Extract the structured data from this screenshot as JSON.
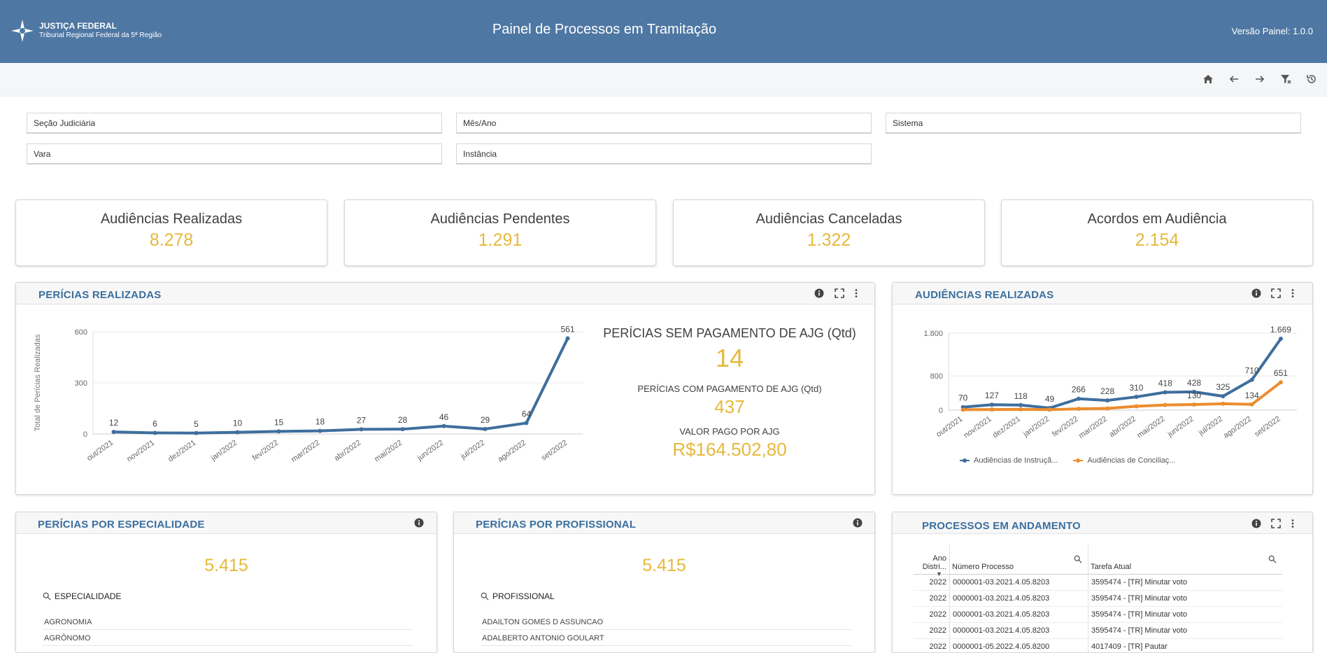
{
  "header": {
    "logo_title": "JUSTIÇA FEDERAL",
    "logo_subtitle": "Tribunal Regional Federal da 5ª Região",
    "title": "Painel de Processos em Tramitação",
    "version": "Versão Painel: 1.0.0"
  },
  "toolbar": {
    "icons": [
      "home-icon",
      "back-icon",
      "forward-icon",
      "clear-filter-icon",
      "history-icon"
    ]
  },
  "filters": {
    "secao": "Seção Judiciária",
    "mes_ano": "Mês/Ano",
    "sistema": "Sistema",
    "vara": "Vara",
    "instancia": "Instância"
  },
  "kpis": [
    {
      "label": "Audiências Realizadas",
      "value": "8.278"
    },
    {
      "label": "Audiências Pendentes",
      "value": "1.291"
    },
    {
      "label": "Audiências Canceladas",
      "value": "1.322"
    },
    {
      "label": "Acordos em Audiência",
      "value": "2.154"
    }
  ],
  "colors": {
    "header": "#4e77a3",
    "accent": "#e6b93b",
    "title": "#3a6f9f",
    "series_blue": "#3e6e9d",
    "series_orange": "#ec8d2e"
  },
  "pericias": {
    "title": "PERÍCIAS REALIZADAS",
    "sem_pagamento_label": "PERÍCIAS SEM PAGAMENTO DE AJG (Qtd)",
    "sem_pagamento_value": "14",
    "com_pagamento_label": "PERÍCIAS COM PAGAMENTO DE AJG (Qtd)",
    "com_pagamento_value": "437",
    "valor_label": "VALOR PAGO POR AJG",
    "valor_value": "R$164.502,80"
  },
  "audiencias_panel": {
    "title": "AUDIÊNCIAS REALIZADAS",
    "legend": [
      "Audiências de Instruçã...",
      "Audiências de Conciliaç..."
    ]
  },
  "especialidade": {
    "title": "PERÍCIAS POR ESPECIALIDADE",
    "total": "5.415",
    "header": "ESPECIALIDADE",
    "items": [
      "AGRONOMIA",
      "AGRÔNOMO"
    ]
  },
  "profissional": {
    "title": "PERÍCIAS POR PROFISSIONAL",
    "total": "5.415",
    "header": "PROFISSIONAL",
    "items": [
      "ADAILTON GOMES D ASSUNCAO",
      "ADALBERTO ANTONIO GOULART"
    ]
  },
  "processos": {
    "title": "PROCESSOS EM ANDAMENTO",
    "columns": [
      "Ano Distri...",
      "Número Processo",
      "Tarefa Atual"
    ],
    "rows": [
      [
        "2022",
        "0000001-03.2021.4.05.8203",
        "3595474 - [TR] Minutar voto"
      ],
      [
        "2022",
        "0000001-03.2021.4.05.8203",
        "3595474 - [TR] Minutar voto"
      ],
      [
        "2022",
        "0000001-03.2021.4.05.8203",
        "3595474 - [TR] Minutar voto"
      ],
      [
        "2022",
        "0000001-03.2021.4.05.8203",
        "3595474 - [TR] Minutar voto"
      ],
      [
        "2022",
        "0000001-05.2022.4.05.8200",
        "4017409 - [TR] Pautar"
      ]
    ]
  },
  "chart_data": [
    {
      "type": "line",
      "ylabel": "Total de Perícias Realizadas",
      "ylim": [
        0,
        600
      ],
      "yticks": [
        0,
        300,
        600
      ],
      "categories": [
        "out/2021",
        "nov/2021",
        "dez/2021",
        "jan/2022",
        "fev/2022",
        "mar/2022",
        "abr/2022",
        "mai/2022",
        "jun/2022",
        "jul/2022",
        "ago/2022",
        "set/2022"
      ],
      "values": [
        12,
        6,
        5,
        10,
        15,
        18,
        27,
        28,
        46,
        29,
        64,
        561
      ]
    },
    {
      "type": "line",
      "ylim": [
        0,
        1800
      ],
      "yticks": [
        "0",
        "800",
        "1.800"
      ],
      "categories": [
        "out/2021",
        "nov/2021",
        "dez/2021",
        "jan/2022",
        "fev/2022",
        "mar/2022",
        "abr/2022",
        "mai/2022",
        "jun/2022",
        "jul/2022",
        "ago/2022",
        "set/2022"
      ],
      "series": [
        {
          "name": "Audiências de Instruçã...",
          "values": [
            70,
            127,
            118,
            49,
            266,
            228,
            310,
            418,
            428,
            325,
            710,
            1669
          ],
          "labels": [
            "70",
            "127",
            "118",
            "49",
            "266",
            "228",
            "310",
            "418",
            "428",
            "325",
            "710",
            "1.669"
          ]
        },
        {
          "name": "Audiências de Conciliaç...",
          "values": [
            10,
            15,
            18,
            12,
            30,
            40,
            90,
            120,
            130,
            150,
            134,
            651
          ],
          "labels": [
            "",
            "",
            "",
            "",
            "",
            "",
            "",
            "",
            "130",
            "",
            "134",
            "651"
          ]
        }
      ]
    }
  ]
}
